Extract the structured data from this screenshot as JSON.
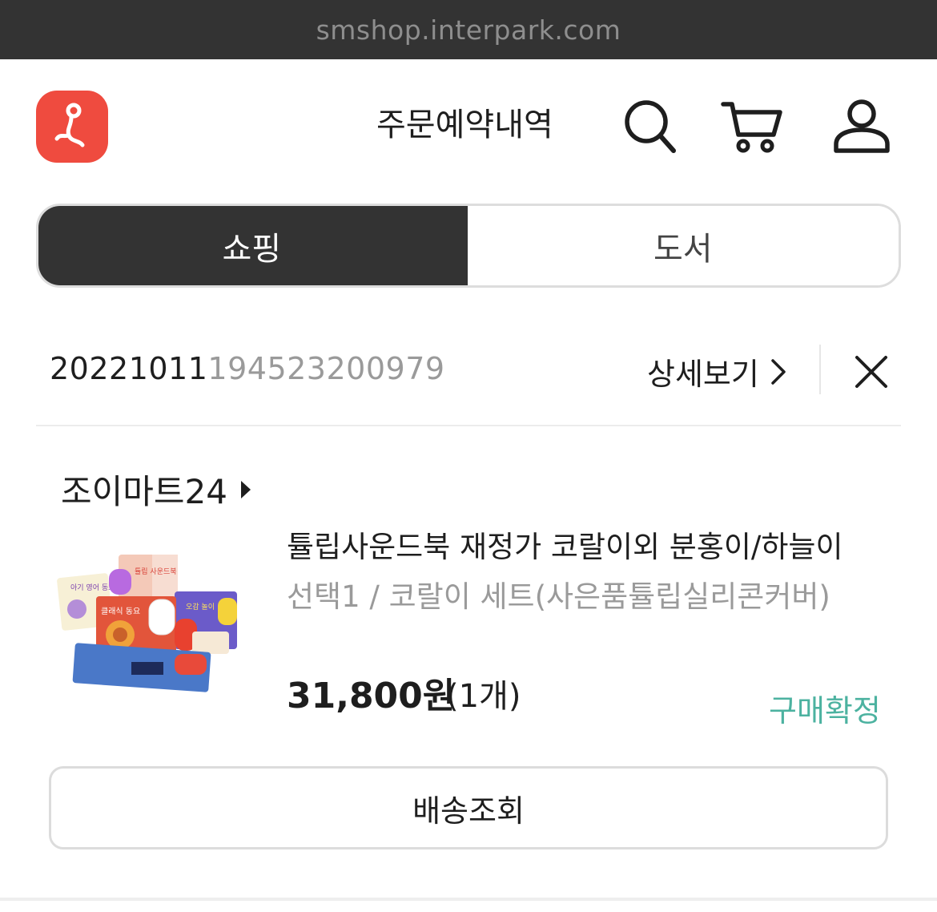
{
  "browser": {
    "url": "smshop.interpark.com"
  },
  "header": {
    "title": "주문예약내역",
    "icons": [
      "search-icon",
      "cart-icon",
      "user-icon"
    ]
  },
  "tabs": [
    {
      "label": "쇼핑",
      "active": true
    },
    {
      "label": "도서",
      "active": false
    }
  ],
  "order": {
    "number_prefix": "20221011",
    "number_suffix": "194523200979",
    "detail_label": "상세보기"
  },
  "seller": {
    "name": "조이마트24"
  },
  "product": {
    "name": "튤립사운드북 재정가 코랄이외 분홍이/하늘이",
    "option": "선택1 / 코랄이 세트(사은품튤립실리콘커버)",
    "price": "31,800원",
    "quantity": "(1개)",
    "status": "구매확정",
    "status_color": "#4cb2a0",
    "thumb_text": {
      "book1": "아기 영어 동요",
      "book2": "클래식 동요",
      "box": "튤립 사운드북",
      "book3": "오감 놀이"
    }
  },
  "actions": {
    "track_label": "배송조회"
  },
  "colors": {
    "accent": "#ef4b3f",
    "dark": "#333333"
  }
}
